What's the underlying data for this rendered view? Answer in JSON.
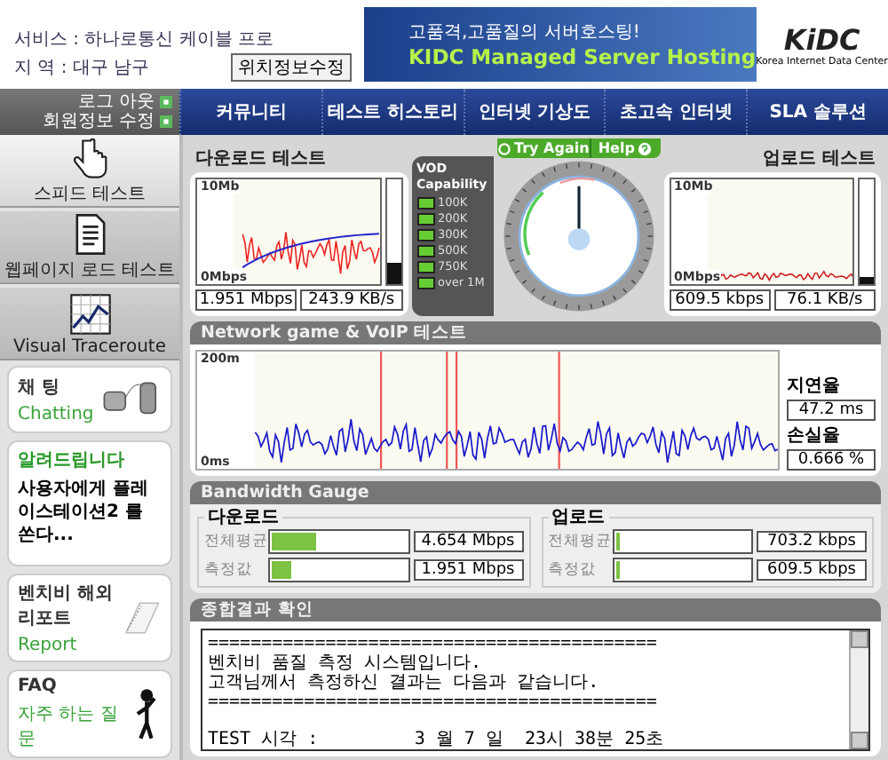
{
  "header": {
    "service_label": "서비스 : 하나로통신 케이블 프로",
    "region_label": "지 역 : 대구 남구",
    "location_button": "위치정보수정"
  },
  "banner": {
    "tagline": "고품격,고품질의 서버호스팅!",
    "headline": "KIDC Managed Server Hosting",
    "logo": "KiDC",
    "logo_caption": "Korea Internet Data Center"
  },
  "account_links": [
    "로그 아웃",
    "회원정보 수정"
  ],
  "nav": [
    "커뮤니티",
    "테스트 히스토리",
    "인터넷 기상도",
    "초고속 인터넷",
    "SLA 솔루션"
  ],
  "tools": [
    {
      "kind": "hand",
      "label": "스피드 테스트",
      "selected": true
    },
    {
      "kind": "document",
      "label": "웹페이지 로드 테스트",
      "selected": false
    },
    {
      "kind": "graph",
      "label": "Visual Traceroute",
      "selected": false
    }
  ],
  "cards": [
    {
      "kind": "chat",
      "title": "채 팅",
      "subtitle": "Chatting"
    },
    {
      "kind": "notice",
      "title": "알려드립니다",
      "body": "사용자에게 플레이스테이션2 를 쏜다..."
    },
    {
      "kind": "report",
      "title": "벤치비 해외 리포트",
      "subtitle": "Report"
    },
    {
      "kind": "faq",
      "title": "FAQ",
      "subtitle": "자주 하는 질문"
    }
  ],
  "download": {
    "title": "다운로드 테스트",
    "y_max": "10Mb",
    "y_min": "0Mbps",
    "level": 0.2,
    "speed": "1.951 Mbps",
    "rate": "243.9 KB/s"
  },
  "vod": {
    "title": "VOD Capability",
    "levels": [
      {
        "label": "100K",
        "lit": true
      },
      {
        "label": "200K",
        "lit": true
      },
      {
        "label": "300K",
        "lit": true
      },
      {
        "label": "500K",
        "lit": true
      },
      {
        "label": "750K",
        "lit": true
      },
      {
        "label": "over 1M",
        "lit": true
      }
    ]
  },
  "gauge": {
    "try_again": "Try Again",
    "help": "Help"
  },
  "upload": {
    "title": "업로드 테스트",
    "y_max": "10Mb",
    "y_min": "0Mbps",
    "level": 0.06,
    "speed": "609.5 kbps",
    "rate": "76.1 KB/s"
  },
  "network": {
    "title": "Network game & VoIP 테스트",
    "y_max": "200m",
    "y_min": "0ms",
    "latency_label": "지연율",
    "latency": "47.2 ms",
    "loss_label": "손실율",
    "loss": "0.666 %"
  },
  "bandwidth": {
    "title": "Bandwidth Gauge",
    "groups": [
      {
        "title": "다운로드",
        "rows": [
          {
            "label": "전체평균",
            "level": 0.33,
            "value": "4.654 Mbps"
          },
          {
            "label": "측정값",
            "level": 0.14,
            "value": "1.951 Mbps"
          }
        ]
      },
      {
        "title": "업로드",
        "rows": [
          {
            "label": "전체평균",
            "level": 0.03,
            "value": "703.2 kbps"
          },
          {
            "label": "측정값",
            "level": 0.03,
            "value": "609.5 kbps"
          }
        ]
      }
    ]
  },
  "summary": {
    "title": "종합결과 확인",
    "lines": [
      "==========================================",
      "벤치비 품질 측정 시스템입니다.",
      "고객님께서 측정하신 결과는 다음과 같습니다.",
      "==========================================",
      "TEST 시각 :         3 월 7 일  23시 38분 25초"
    ]
  }
}
